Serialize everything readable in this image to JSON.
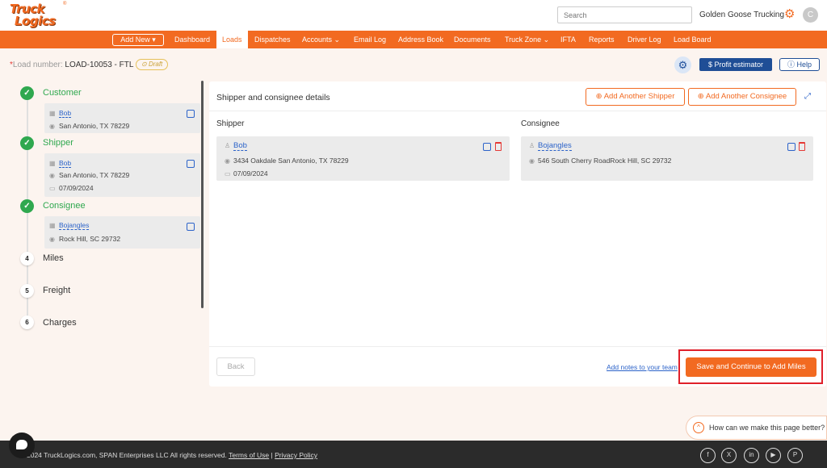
{
  "header": {
    "logo_line1": "Truck",
    "logo_line2": "Logics",
    "logo_reg": "®",
    "search_placeholder": "Search",
    "company": "Golden Goose Trucking",
    "avatar_initial": "C"
  },
  "nav": {
    "add_new": "Add New ▾",
    "items": [
      "Dashboard",
      "Loads",
      "Dispatches",
      "Accounts ⌄",
      "Email Log",
      "Address Book",
      "Documents",
      "Truck Zone ⌄",
      "IFTA",
      "Reports",
      "Driver Log",
      "Load Board"
    ],
    "active": "Loads"
  },
  "load": {
    "label": "Load number: ",
    "number": "LOAD-10053 - FTL",
    "status": "Draft",
    "profit_btn": "$ Profit estimator",
    "help_btn": "Help"
  },
  "steps": [
    {
      "num": "✓",
      "title": "Customer",
      "done": true
    },
    {
      "num": "✓",
      "title": "Shipper",
      "done": true
    },
    {
      "num": "✓",
      "title": "Consignee",
      "done": true
    },
    {
      "num": "4",
      "title": "Miles",
      "done": false
    },
    {
      "num": "5",
      "title": "Freight",
      "done": false
    },
    {
      "num": "6",
      "title": "Charges",
      "done": false
    }
  ],
  "step_cards": {
    "customer": {
      "name": "Bob",
      "address": "San Antonio, TX 78229"
    },
    "shipper": {
      "name": "Bob",
      "address": "San Antonio, TX 78229",
      "date": "07/09/2024"
    },
    "consignee": {
      "name": "Bojangles",
      "address": "Rock Hill, SC 29732"
    }
  },
  "panel": {
    "title": "Shipper and consignee details",
    "add_shipper": "Add Another Shipper",
    "add_consignee": "Add Another Consignee",
    "shipper_label": "Shipper",
    "consignee_label": "Consignee",
    "shipper": {
      "name": "Bob",
      "address": "3434 Oakdale  San Antonio,  TX  78229",
      "date": "07/09/2024"
    },
    "consignee": {
      "name": "Bojangles",
      "address": "546 South Cherry RoadRock Hill, SC 29732"
    },
    "back": "Back",
    "notes_link": "Add notes to your team",
    "save": "Save and Continue to Add Miles"
  },
  "feedback": "How can we make this page better?",
  "footer": {
    "copyright": "2024 TruckLogics.com, SPAN Enterprises LLC All rights reserved.",
    "terms": "Terms of Use",
    "sep": "|",
    "privacy": "Privacy Policy",
    "social": [
      "f",
      "X",
      "in",
      "▶",
      "P"
    ]
  },
  "colors": {
    "brand": "#f26a21",
    "done": "#2fa84f",
    "link": "#2c63c9",
    "navy": "#1f4e96"
  }
}
